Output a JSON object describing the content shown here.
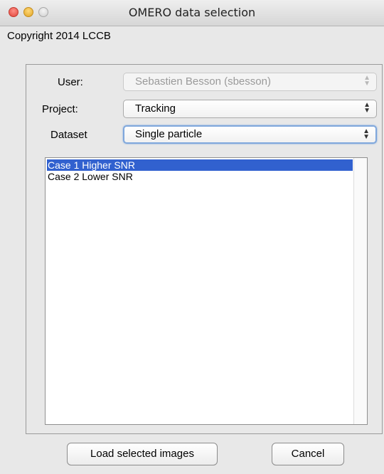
{
  "window": {
    "title": "OMERO data selection"
  },
  "copyright": "Copyright 2014 LCCB",
  "form": {
    "user": {
      "label": "User:",
      "value": "Sebastien Besson (sbesson)",
      "disabled": true
    },
    "project": {
      "label": "Project:",
      "value": "Tracking"
    },
    "dataset": {
      "label": "Dataset",
      "value": "Single particle"
    }
  },
  "images": {
    "items": [
      {
        "label": "Case 1 Higher SNR",
        "selected": true
      },
      {
        "label": "Case 2 Lower SNR",
        "selected": false
      }
    ]
  },
  "buttons": {
    "load": "Load selected images",
    "cancel": "Cancel"
  },
  "icons": {
    "updown": "↕"
  },
  "colors": {
    "selection": "#3161cf",
    "focus_ring": "#7fa7dc"
  }
}
